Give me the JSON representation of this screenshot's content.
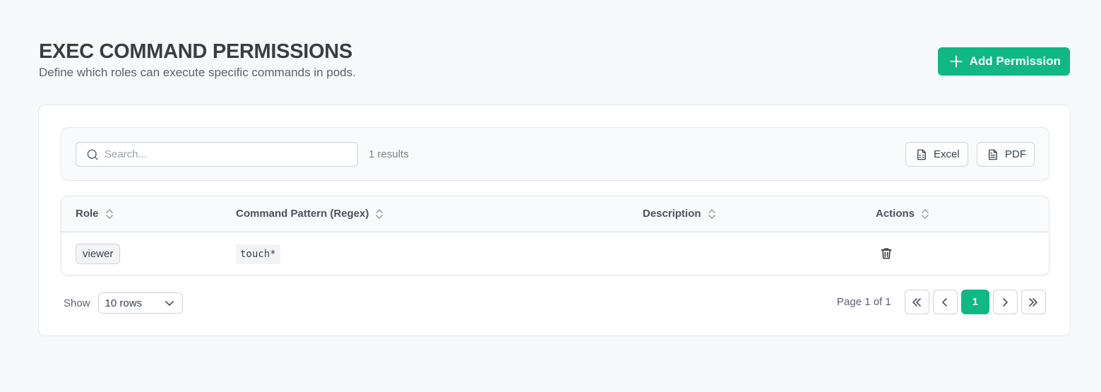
{
  "header": {
    "title": "EXEC COMMAND PERMISSIONS",
    "subtitle": "Define which roles can execute specific commands in pods.",
    "add_button_label": "Add Permission",
    "add_icon": "plus-icon"
  },
  "toolbar": {
    "search_placeholder": "Search...",
    "search_value": "",
    "results_text": "1 results",
    "excel_label": "Excel",
    "pdf_label": "PDF"
  },
  "table": {
    "columns": [
      "Role",
      "Command Pattern (Regex)",
      "Description",
      "Actions"
    ],
    "rows": [
      {
        "role": "viewer",
        "command": "touch*",
        "description": ""
      }
    ]
  },
  "footer": {
    "show_label": "Show",
    "rows_option": "10 rows",
    "page_info": "Page 1 of 1",
    "current_page": "1"
  },
  "colors": {
    "accent": "#10b981",
    "background": "#f8f9fb"
  }
}
